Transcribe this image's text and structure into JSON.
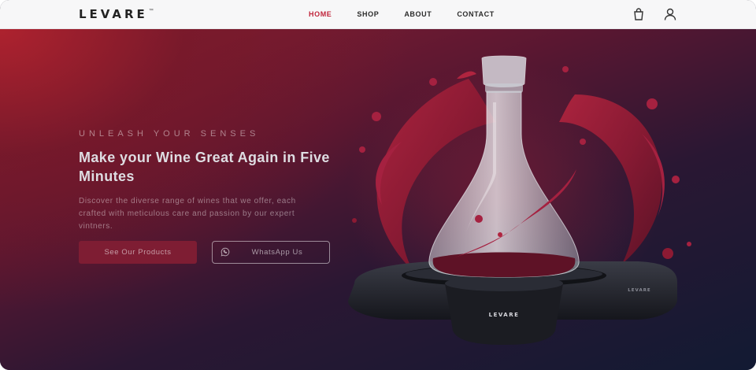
{
  "header": {
    "logo": {
      "text": "LEVARE",
      "tm": "™"
    },
    "nav": [
      {
        "label": "HOME",
        "active": true
      },
      {
        "label": "SHOP",
        "active": false
      },
      {
        "label": "ABOUT",
        "active": false
      },
      {
        "label": "CONTACT",
        "active": false
      }
    ],
    "icons": [
      "shopping-bag-icon",
      "user-icon"
    ]
  },
  "hero": {
    "eyebrow": "UNLEASH YOUR SENSES",
    "headline": "Make your Wine Great Again in Five Minutes",
    "description": "Discover the diverse range of wines that we offer, each crafted with meticulous care and passion by our expert vintners.",
    "primary_button": "See Our Products",
    "secondary_button": "WhatsApp Us",
    "product_base_label": "LEVARE",
    "product_side_label": "LEVARE"
  },
  "colors": {
    "accent": "#c0243a",
    "button_primary": "#7e1d33",
    "wine": "#8c1a33"
  }
}
